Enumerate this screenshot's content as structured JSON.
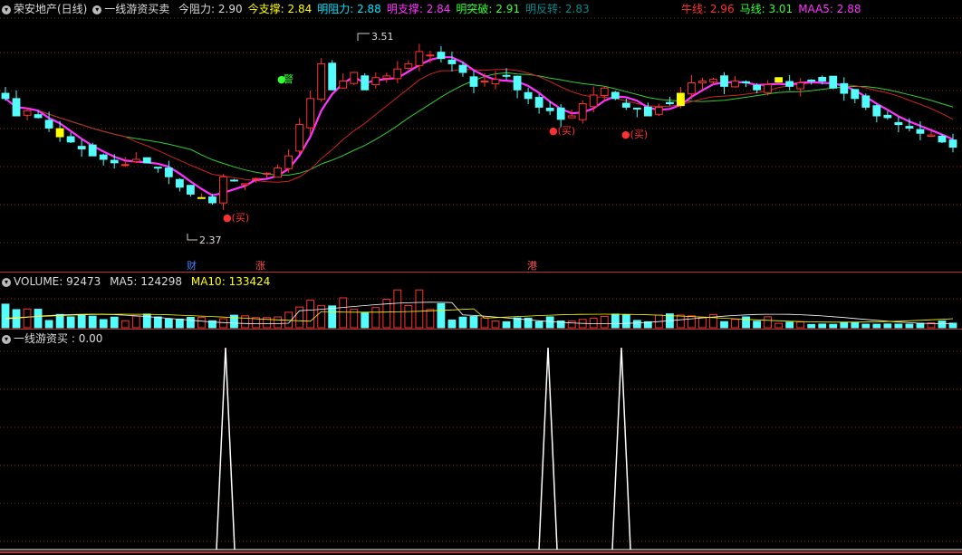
{
  "header": {
    "title": "荣安地产(日线)",
    "indicator": "一线游资买卖",
    "items": [
      {
        "label": "今阻力:",
        "value": "2.90",
        "lc": "#dcdcdc",
        "vc": "#dcdcdc"
      },
      {
        "label": "今支撑:",
        "value": "2.84",
        "lc": "#ffff00",
        "vc": "#ffff00"
      },
      {
        "label": "明阻力:",
        "value": "2.88",
        "lc": "#00e5ff",
        "vc": "#00e5ff"
      },
      {
        "label": "明支撑:",
        "value": "2.84",
        "lc": "#ff33ff",
        "vc": "#ff33ff"
      },
      {
        "label": "明突破:",
        "value": "2.91",
        "lc": "#33ff33",
        "vc": "#33ff33"
      },
      {
        "label": "明反转:",
        "value": "2.83",
        "lc": "#008b8b",
        "vc": "#008b8b"
      }
    ],
    "right": [
      {
        "label": "牛线:",
        "value": "2.96",
        "c": "#ff3030"
      },
      {
        "label": "马线:",
        "value": "3.01",
        "c": "#33ff33"
      },
      {
        "label": "MAA5:",
        "value": "2.88",
        "c": "#ff33ff"
      }
    ]
  },
  "volume_header": {
    "label": "VOLUME:",
    "value": "92473",
    "ma5_label": "MA5:",
    "ma5_value": "124298",
    "ma10_label": "MA10:",
    "ma10_value": "133424"
  },
  "signal_header": {
    "label": "一线游资买",
    "value": ": 0.00"
  },
  "annotations": {
    "high": "3.51",
    "low": "2.37",
    "buy": "●(买)",
    "warn": "警",
    "events": [
      "财",
      "涨",
      "港"
    ]
  },
  "colors": {
    "up": "#ff3232",
    "down": "#54fcfc",
    "bg": "#000000",
    "ma_slow": "#33cc33",
    "ma_mid": "#cc2222",
    "ma_fast": "#ff33ff",
    "grid": "#8b1a1a"
  },
  "chart_data": [
    {
      "type": "candlestick",
      "title": "荣安地产(日线)",
      "annotated_high": 3.51,
      "annotated_low": 2.37,
      "close_estimate": [
        3.15,
        3.05,
        3.08,
        3.04,
        2.98,
        2.93,
        2.9,
        2.86,
        2.82,
        2.8,
        2.78,
        2.77,
        2.8,
        2.78,
        2.75,
        2.7,
        2.64,
        2.6,
        2.58,
        2.55,
        2.7,
        2.68,
        2.66,
        2.69,
        2.72,
        2.75,
        2.82,
        3.0,
        3.15,
        3.35,
        3.2,
        3.25,
        3.3,
        3.2,
        3.27,
        3.28,
        3.32,
        3.35,
        3.42,
        3.4,
        3.38,
        3.35,
        3.3,
        3.22,
        3.25,
        3.26,
        3.28,
        3.2,
        3.15,
        3.1,
        3.08,
        3.03,
        3.05,
        3.12,
        3.17,
        3.21,
        3.15,
        3.1,
        3.09,
        3.05,
        3.1,
        3.12,
        3.18,
        3.24,
        3.25,
        3.26,
        3.22,
        3.25,
        3.24,
        3.2,
        3.23,
        3.27,
        3.22,
        3.24,
        3.25,
        3.25,
        3.21,
        3.18,
        3.15,
        3.1,
        3.05,
        3.04,
        3.0,
        2.98,
        2.95,
        2.94,
        2.9,
        2.87
      ]
    },
    {
      "type": "bar",
      "title": "VOLUME",
      "latest": 92473,
      "ma5": 124298,
      "ma10": 133424
    },
    {
      "type": "line",
      "title": "一线游资买",
      "latest": 0.0,
      "spike_count": 3
    }
  ]
}
